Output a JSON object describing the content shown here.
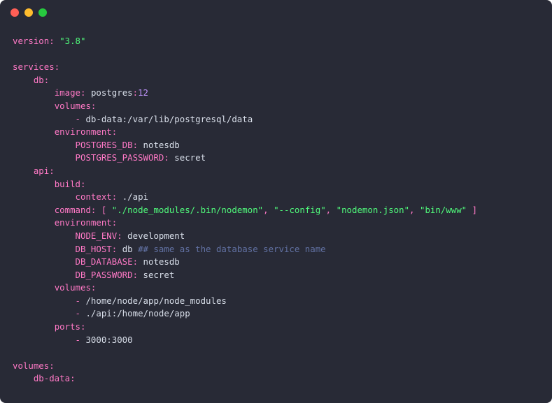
{
  "line1_key": "version",
  "line1_val": "\"3.8\"",
  "services_key": "services",
  "db_key": "db",
  "image_key": "image",
  "image_val": "postgres",
  "image_tag": "12",
  "volumes_key": "volumes",
  "db_volume": "db-data:/var/lib/postgresql/data",
  "environment_key": "environment",
  "pg_db_key": "POSTGRES_DB",
  "pg_db_val": "notesdb",
  "pg_pw_key": "POSTGRES_PASSWORD",
  "pg_pw_val": "secret",
  "api_key": "api",
  "build_key": "build",
  "context_key": "context",
  "context_val": "./api",
  "command_key": "command",
  "cmd_a": "\"./node_modules/.bin/nodemon\"",
  "cmd_b": "\"--config\"",
  "cmd_c": "\"nodemon.json\"",
  "cmd_d": "\"bin/www\"",
  "node_env_key": "NODE_ENV",
  "node_env_val": "development",
  "db_host_key": "DB_HOST",
  "db_host_val": "db",
  "db_host_comment": "## same as the database service name",
  "db_database_key": "DB_DATABASE",
  "db_database_val": "notesdb",
  "db_password_key": "DB_PASSWORD",
  "db_password_val": "secret",
  "api_vol1": "/home/node/app/node_modules",
  "api_vol2": "./api:/home/node/app",
  "ports_key": "ports",
  "port1": "3000:3000",
  "top_volumes_key": "volumes",
  "db_data_key": "db-data",
  "colon": ":",
  "dash": "-",
  "lbr": "[",
  "rbr": "]",
  "comma": ","
}
